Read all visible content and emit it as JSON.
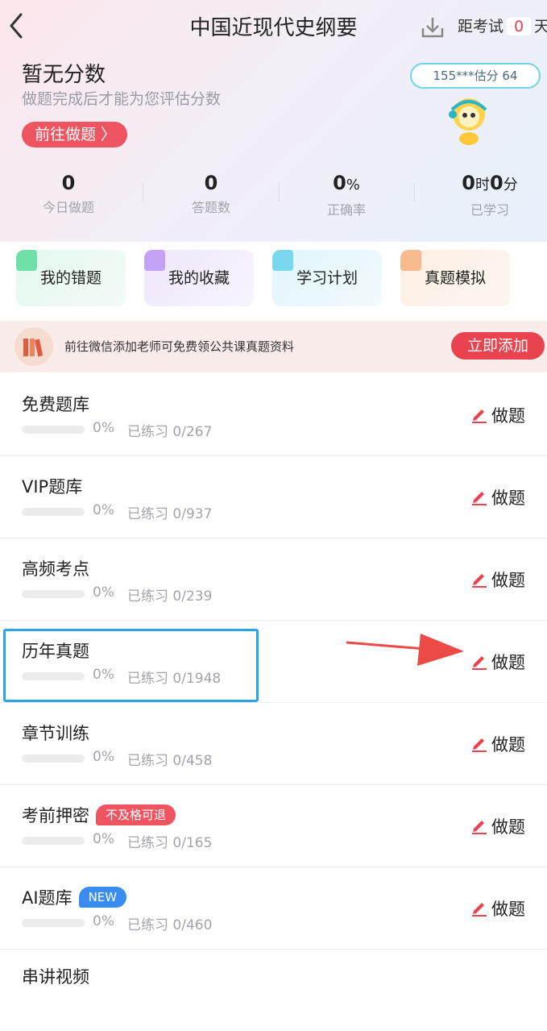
{
  "header": {
    "title": "中国近现代史纲要",
    "exam_prefix": "距考试",
    "exam_days": "0",
    "exam_suffix": "天"
  },
  "score": {
    "heading": "暂无分数",
    "subtext": "做题完成后才能为您评估分数",
    "button": "前往做题 〉",
    "bubble": "155***估分 64"
  },
  "stats": [
    {
      "value": "0",
      "label": "今日做题"
    },
    {
      "value": "0",
      "label": "答题数"
    },
    {
      "value": "0",
      "unit": "%",
      "label": "正确率"
    },
    {
      "value_h": "0",
      "unit_h": "时",
      "value_m": "0",
      "unit_m": "分",
      "label": "已学习"
    }
  ],
  "quick": [
    {
      "label": "我的错题",
      "color": "#2fd08a"
    },
    {
      "label": "我的收藏",
      "color": "#a874f3"
    },
    {
      "label": "学习计划",
      "color": "#3ec9e6"
    },
    {
      "label": "真题模拟",
      "color": "#f59b5a"
    }
  ],
  "banner": {
    "text": "前往微信添加老师可免费领公共课真题资料",
    "button": "立即添加"
  },
  "banks": [
    {
      "name": "免费题库",
      "tag": "",
      "pct": "0%",
      "progress": "已练习 0/267",
      "action": "做题"
    },
    {
      "name": "VIP题库",
      "tag": "",
      "pct": "0%",
      "progress": "已练习 0/937",
      "action": "做题"
    },
    {
      "name": "高频考点",
      "tag": "",
      "pct": "0%",
      "progress": "已练习 0/239",
      "action": "做题"
    },
    {
      "name": "历年真题",
      "tag": "",
      "pct": "0%",
      "progress": "已练习 0/1948",
      "action": "做题"
    },
    {
      "name": "章节训练",
      "tag": "",
      "pct": "0%",
      "progress": "已练习 0/458",
      "action": "做题"
    },
    {
      "name": "考前押密",
      "tag": "不及格可退",
      "pct": "0%",
      "progress": "已练习 0/165",
      "action": "做题"
    },
    {
      "name": "AI题库",
      "tag": "NEW",
      "pct": "0%",
      "progress": "已练习 0/460",
      "action": "做题"
    },
    {
      "name": "串讲视频",
      "tag": "",
      "pct": "",
      "progress": "",
      "action": ""
    }
  ],
  "colors": {
    "accent": "#e8434e",
    "tag_red": "#ef5560",
    "tag_blue": "#3b8cf0",
    "highlight": "#2ba4e6"
  }
}
